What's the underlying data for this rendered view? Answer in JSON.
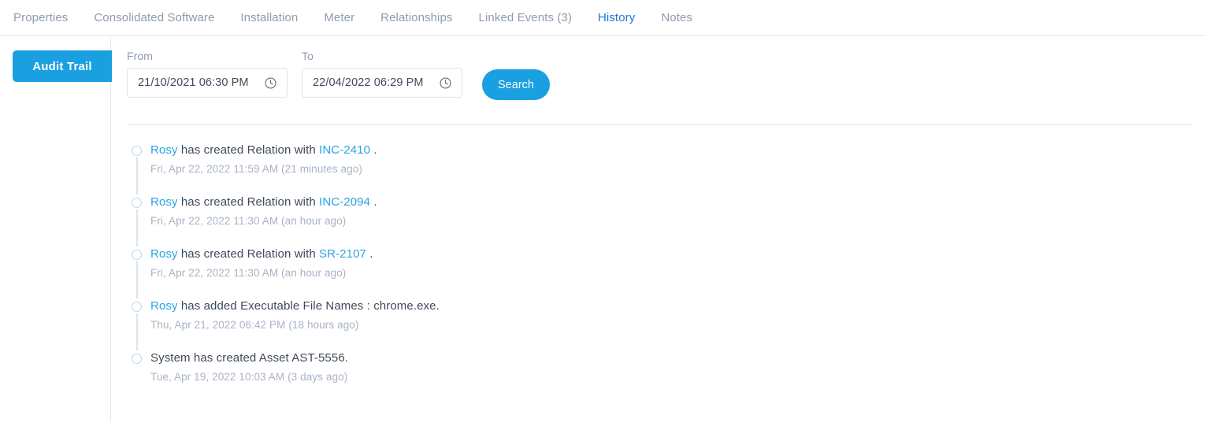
{
  "tabs": [
    {
      "label": "Properties",
      "active": false
    },
    {
      "label": "Consolidated Software",
      "active": false
    },
    {
      "label": "Installation",
      "active": false
    },
    {
      "label": "Meter",
      "active": false
    },
    {
      "label": "Relationships",
      "active": false
    },
    {
      "label": "Linked Events (3)",
      "active": false
    },
    {
      "label": "History",
      "active": true
    },
    {
      "label": "Notes",
      "active": false
    }
  ],
  "sidebar": {
    "audit_trail_label": "Audit Trail"
  },
  "filters": {
    "from": {
      "label": "From",
      "value": "21/10/2021 06:30 PM",
      "icon": "clock-icon"
    },
    "to": {
      "label": "To",
      "value": "22/04/2022 06:29 PM",
      "icon": "clock-icon"
    },
    "search_label": "Search"
  },
  "timeline": [
    {
      "actor": "Rosy",
      "text_before": " has created Relation with ",
      "link": "INC-2410",
      "text_after": " .",
      "date": "Fri, Apr 22, 2022 11:59 AM (21 minutes ago)"
    },
    {
      "actor": "Rosy",
      "text_before": " has created Relation with ",
      "link": "INC-2094",
      "text_after": " .",
      "date": "Fri, Apr 22, 2022 11:30 AM (an hour ago)"
    },
    {
      "actor": "Rosy",
      "text_before": " has created Relation with ",
      "link": "SR-2107",
      "text_after": " .",
      "date": "Fri, Apr 22, 2022 11:30 AM (an hour ago)"
    },
    {
      "actor": "Rosy",
      "text_before": " has added Executable File Names : chrome.exe.",
      "link": "",
      "text_after": "",
      "date": "Thu, Apr 21, 2022 06:42 PM (18 hours ago)"
    },
    {
      "actor": "",
      "text_before": "System has created Asset AST-5556.",
      "link": "",
      "text_after": "",
      "date": "Tue, Apr 19, 2022 10:03 AM (3 days ago)"
    }
  ],
  "annotation": {
    "target_tab": "History",
    "box_color": "#ef4136"
  },
  "colors": {
    "accent_blue": "#1a9fe0",
    "active_tab_blue": "#1a7ad1",
    "tab_underline": "#3b7cc4",
    "tab_inactive": "#8e9bae",
    "body_text": "#3f4a5a",
    "muted_text": "#a8b3c4",
    "link": "#29a3e3",
    "border": "#dde4ed"
  }
}
